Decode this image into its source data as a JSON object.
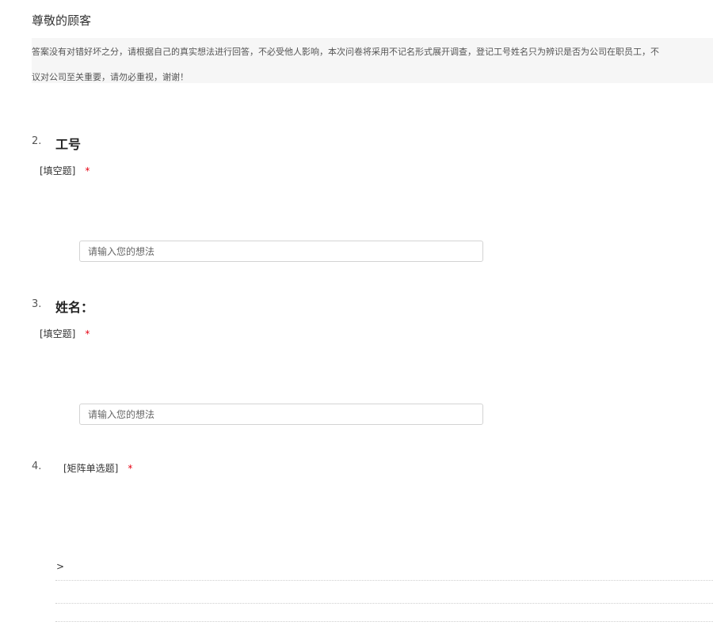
{
  "header": {
    "greeting": "尊敬的顾客",
    "intro": "答案没有对错好坏之分，请根据自己的真实想法进行回答，不必受他人影响，本次问卷将采用不记名形式展开调查，登记工号姓名只为辨识是否为公司在职员工，不",
    "intro_cont": "议对公司至关重要，请勿必重视，谢谢！"
  },
  "questions": [
    {
      "number": "2.",
      "title": "工号",
      "type": "[填空题]",
      "required_mark": "*",
      "placeholder": "请输入您的想法"
    },
    {
      "number": "3.",
      "title": "姓名：",
      "type": "[填空题]",
      "required_mark": "*",
      "placeholder": "请输入您的想法"
    }
  ],
  "matrix": {
    "number": "4.",
    "type": "[矩阵单选题]",
    "required_mark": "*",
    "row_marker": ">"
  }
}
